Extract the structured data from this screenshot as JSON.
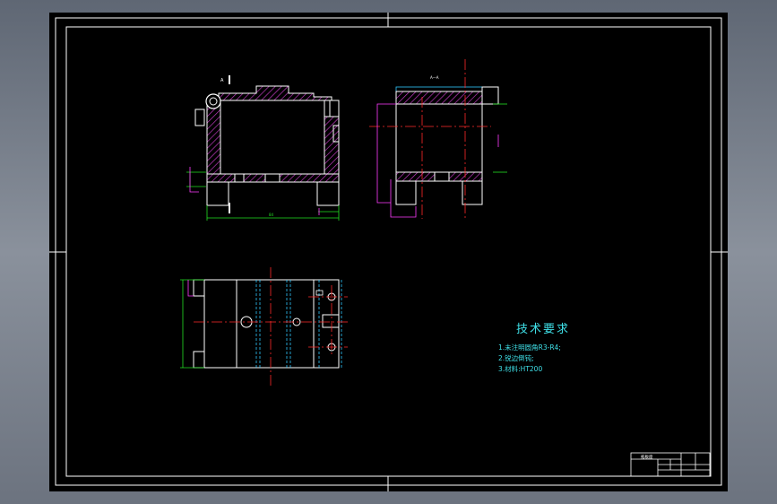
{
  "drawing": {
    "section_label_a": "A",
    "section_label_top": "A—A",
    "dimension_width": "84"
  },
  "tech_requirements": {
    "title": "技术要求",
    "items": [
      "1.未注明圆角R3-R4;",
      "2.锐边倒钝;",
      "3.材料:HT200"
    ]
  },
  "title_block": {
    "name": "拓板座"
  },
  "colors": {
    "paper": "#000000",
    "frame": "#ffffff",
    "outline": "#ffffff",
    "hatch": "#c83cc8",
    "center_line": "#ff2a2a",
    "dimension": "#22e022",
    "leader": "#ff3cff",
    "hidden": "#30c8ff",
    "text": "#3fe0e8"
  }
}
